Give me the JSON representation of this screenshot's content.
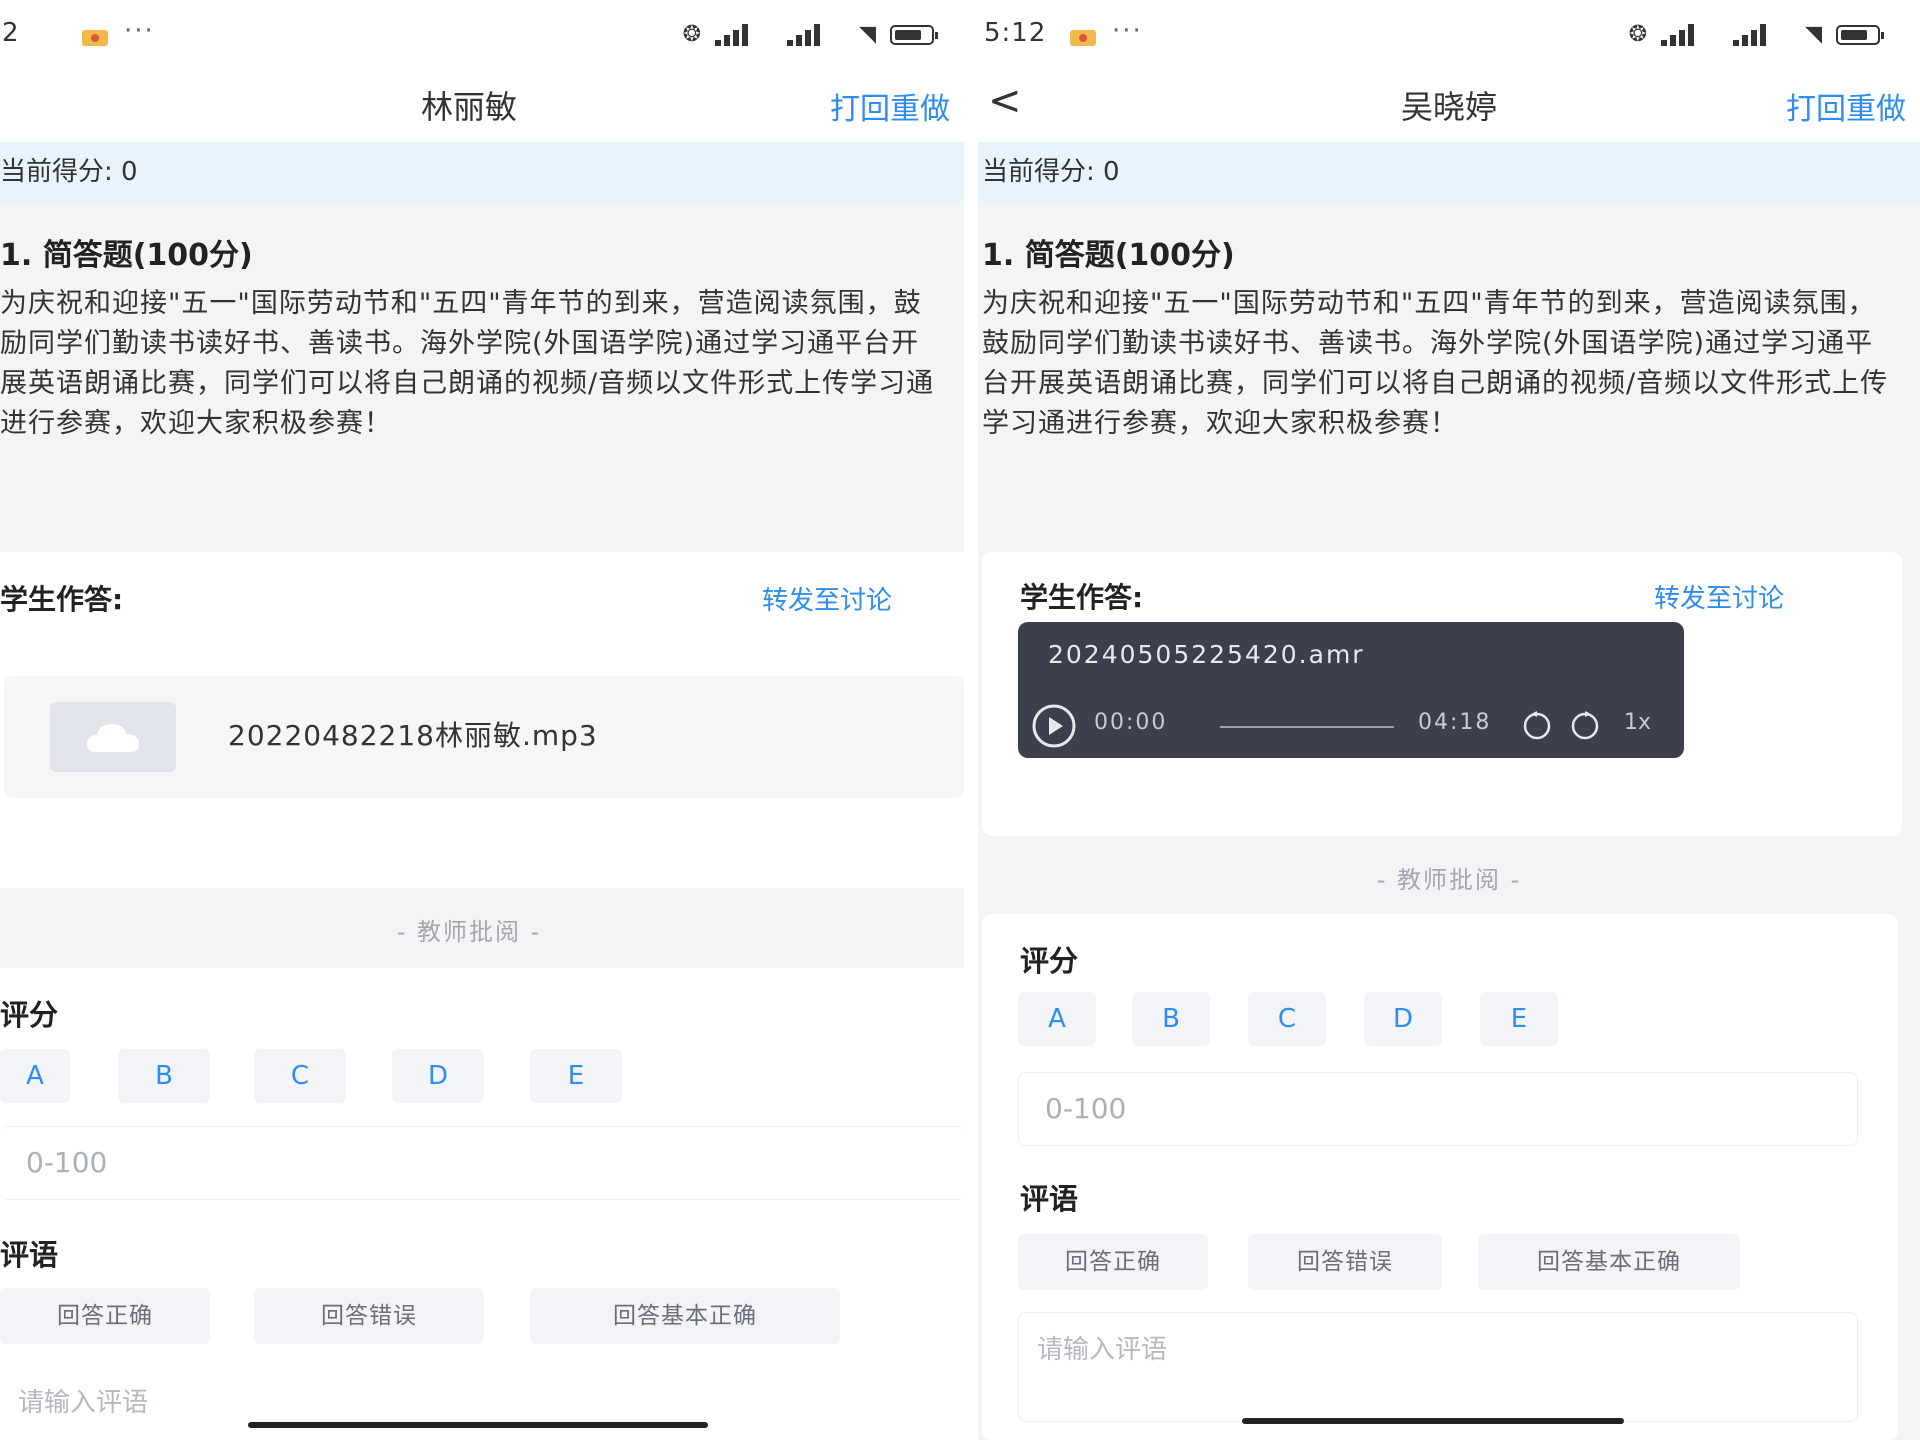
{
  "left_panel": {
    "status": {
      "time": "2",
      "more": "···"
    },
    "nav": {
      "title": "林丽敏",
      "action": "打回重做"
    },
    "score_label": "当前得分: 0",
    "question": {
      "title": "1. 简答题(100分)",
      "text": "为庆祝和迎接\"五一\"国际劳动节和\"五四\"青年节的到来，营造阅读氛围，鼓励同学们勤读书读好书、善读书。海外学院(外国语学院)通过学习通平台开展英语朗诵比赛，同学们可以将自己朗诵的视频/音频以文件形式上传学习通进行参赛，欢迎大家积极参赛！"
    },
    "answer": {
      "label": "学生作答:",
      "forward": "转发至讨论",
      "file_name": "20220482218林丽敏.mp3"
    },
    "review": {
      "divider": "- 教师批阅 -",
      "grade_label": "评分",
      "grades": [
        "A",
        "B",
        "C",
        "D",
        "E"
      ],
      "score_placeholder": "0-100",
      "comment_label": "评语",
      "comment_chips": [
        "回答正确",
        "回答错误",
        "回答基本正确"
      ],
      "comment_placeholder": "请输入评语"
    }
  },
  "right_panel": {
    "status": {
      "time": "5:12",
      "more": "···"
    },
    "nav": {
      "back": "<",
      "title": "吴晓婷",
      "action": "打回重做"
    },
    "score_label": "当前得分: 0",
    "question": {
      "title": "1. 简答题(100分)",
      "text": "为庆祝和迎接\"五一\"国际劳动节和\"五四\"青年节的到来，营造阅读氛围，鼓励同学们勤读书读好书、善读书。海外学院(外国语学院)通过学习通平台开展英语朗诵比赛，同学们可以将自己朗诵的视频/音频以文件形式上传学习通进行参赛，欢迎大家积极参赛！"
    },
    "answer": {
      "label": "学生作答:",
      "forward": "转发至讨论",
      "audio": {
        "file_name": "20240505225420.amr",
        "current_time": "00:00",
        "duration": "04:18",
        "speed": "1x"
      }
    },
    "review": {
      "divider": "- 教师批阅 -",
      "grade_label": "评分",
      "grades": [
        "A",
        "B",
        "C",
        "D",
        "E"
      ],
      "score_placeholder": "0-100",
      "comment_label": "评语",
      "comment_chips": [
        "回答正确",
        "回答错误",
        "回答基本正确"
      ],
      "comment_placeholder": "请输入评语"
    }
  },
  "colors": {
    "accent": "#2f8cf0",
    "score_strip": "#e9f3fc",
    "player_bg": "#3b3f4e"
  }
}
